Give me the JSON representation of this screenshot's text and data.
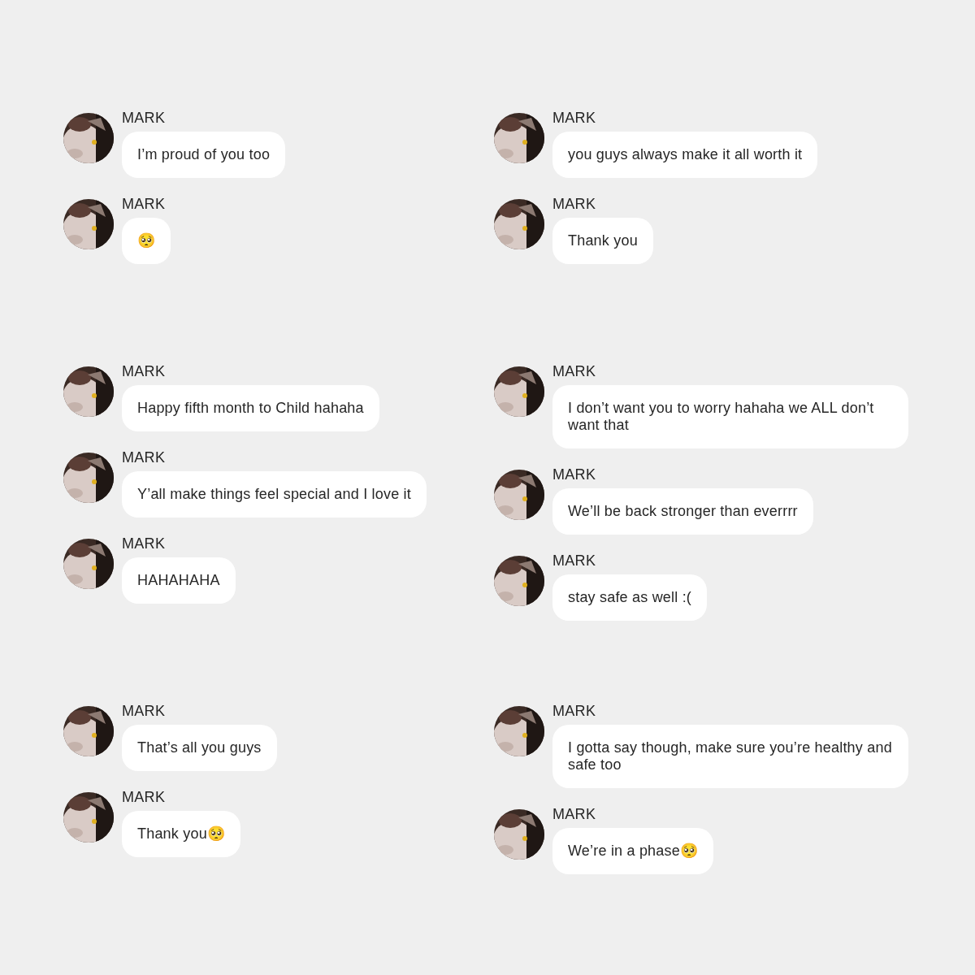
{
  "groups": [
    {
      "messages": [
        {
          "sender": "MARK",
          "text": "I’m proud of you too"
        },
        {
          "sender": "MARK",
          "text": "🥺"
        }
      ]
    },
    {
      "messages": [
        {
          "sender": "MARK",
          "text": "you guys always make it all worth it"
        },
        {
          "sender": "MARK",
          "text": "Thank you"
        }
      ]
    },
    {
      "messages": [
        {
          "sender": "MARK",
          "text": "Happy fifth month to Child hahaha"
        },
        {
          "sender": "MARK",
          "text": "Y’all make things feel special and I love it"
        },
        {
          "sender": "MARK",
          "text": "HAHAHAHA"
        }
      ]
    },
    {
      "messages": [
        {
          "sender": "MARK",
          "text": "I don’t want you to worry hahaha we ALL don’t want that"
        },
        {
          "sender": "MARK",
          "text": "We’ll be back stronger than everrrr"
        },
        {
          "sender": "MARK",
          "text": "stay safe as well :("
        }
      ]
    },
    {
      "messages": [
        {
          "sender": "MARK",
          "text": "That’s all you guys"
        },
        {
          "sender": "MARK",
          "text": "Thank you🥺"
        }
      ]
    },
    {
      "messages": [
        {
          "sender": "MARK",
          "text": "I gotta say though, make sure you’re healthy and safe too"
        },
        {
          "sender": "MARK",
          "text": "We’re in a phase🥺"
        }
      ]
    }
  ]
}
